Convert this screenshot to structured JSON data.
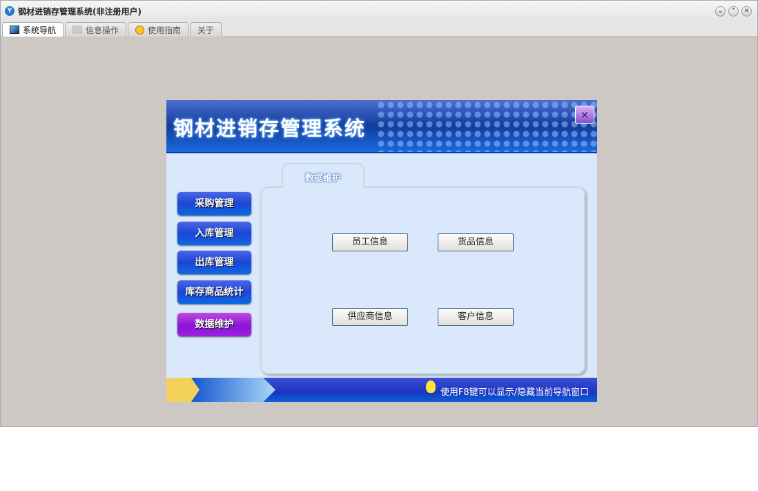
{
  "window": {
    "title": "钢材进销存管理系统(非注册用户)",
    "controls": [
      "minimize",
      "restore",
      "close"
    ]
  },
  "tabs": [
    {
      "label": "系统导航",
      "icon": "monitor-icon",
      "active": true
    },
    {
      "label": "信息操作",
      "icon": "grid-icon"
    },
    {
      "label": "使用指南",
      "icon": "help-icon"
    },
    {
      "label": "关于"
    }
  ],
  "panel": {
    "title": "钢材进销存管理系统",
    "close": "×",
    "sidebar": [
      {
        "label": "采购管理"
      },
      {
        "label": "入库管理"
      },
      {
        "label": "出库管理"
      },
      {
        "label": "库存商品统计"
      },
      {
        "label": "数据维护",
        "active": true
      }
    ],
    "section_tab": "数据维护",
    "buttons": [
      "员工信息",
      "货品信息",
      "供应商信息",
      "客户信息"
    ],
    "footer_hint": "使用F8键可以显示/隐藏当前导航窗口"
  }
}
